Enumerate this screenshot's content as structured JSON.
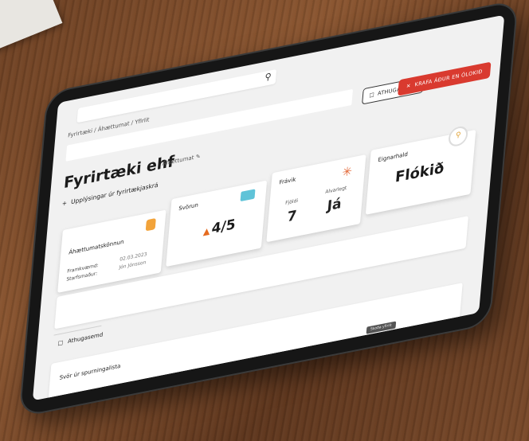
{
  "search": {
    "icon": "search-icon"
  },
  "breadcrumb": "Fyrirtæki / Áhættumat / Yfirlit",
  "header": {
    "comment_button": "ATHUGASEMD",
    "danger_button": "KRAFA ÁÐUR EN ÓLOKIÐ",
    "title": "Fyrirtæki ehf",
    "subtitle": "Áhættumat",
    "add_info": "Upplýsingar úr fyrirtækjaskrá"
  },
  "cards": {
    "risk": {
      "label": "Áhættumatskönnun",
      "row1_label": "Framkvæmd:",
      "row1_value": "02.03.2023",
      "row2_label": "Starfsmaður:",
      "row2_value": "Jón Jónsson"
    },
    "staff": {
      "label": "Svörun",
      "value": "4/5"
    },
    "dev": {
      "label": "Frávik",
      "sub1": "Fjöldi",
      "sub2": "Alvarlegt",
      "n1": "7",
      "n2": "Já"
    },
    "ownership": {
      "label": "Eignarhald",
      "value": "Flókið"
    }
  },
  "note": "Athugasemd",
  "answers": "Svör úr spurningalista",
  "tooltip": "Skoða yfirlit"
}
